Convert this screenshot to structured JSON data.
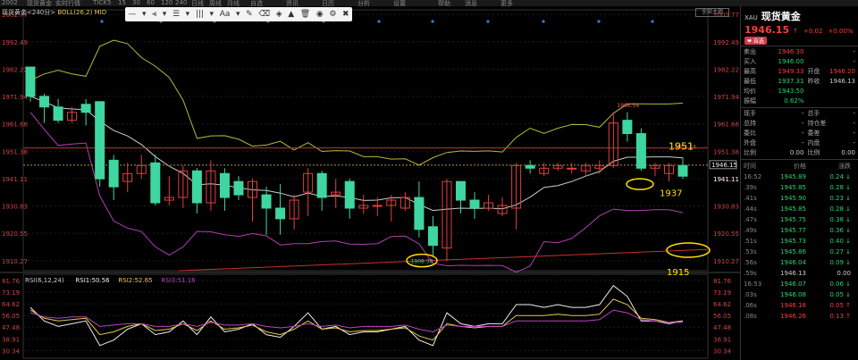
{
  "topbar": [
    "2002",
    "现货黄金",
    "实时行情",
    "TICK",
    "5",
    "15",
    "30",
    "60",
    "120",
    "240",
    "日线",
    "周线",
    "月线",
    "自选",
    "资讯",
    "日历",
    "分析",
    "设置",
    "帮助",
    "消息",
    "更多"
  ],
  "legend": {
    "symbol": "现货黄金<240分>",
    "boll": "BOLL(26,2) MID"
  },
  "toolbar": [
    "—",
    "▾",
    "⫷",
    "▾",
    "☰",
    "▾",
    "|||",
    "▾",
    "Aa",
    "▾",
    "✎",
    "⌫",
    "◈",
    "▲",
    "🗑",
    "◉",
    "⚙",
    "✖"
  ],
  "button_tr": "全部主题",
  "chart_data": {
    "type": "candlestick",
    "y_ticks": [
      2002.77,
      1992.49,
      1982.22,
      1971.94,
      1961.66,
      1951.38,
      1941.11,
      1930.83,
      1920.55,
      1910.27
    ],
    "y_tick_labels": [
      "2002.77",
      "1992.49",
      "1982.22",
      "1971.94",
      "1961.66",
      "1951.38",
      "1941.11",
      "1930.83",
      "1920.55",
      "1910.27"
    ],
    "ylim": [
      1906.5,
      2004.5
    ],
    "candles": [
      [
        1983,
        1972,
        1983,
        1970
      ],
      [
        1972,
        1968,
        1973,
        1962
      ],
      [
        1968,
        1963,
        1971,
        1962
      ],
      [
        1963,
        1966,
        1968,
        1962
      ],
      [
        1969,
        1966,
        1971,
        1961
      ],
      [
        1970,
        1941,
        1970,
        1938
      ],
      [
        1948,
        1938,
        1950,
        1933
      ],
      [
        1940,
        1943,
        1947,
        1936
      ],
      [
        1943,
        1946,
        1950,
        1941
      ],
      [
        1947,
        1932,
        1950,
        1931
      ],
      [
        1933,
        1934,
        1942,
        1931
      ],
      [
        1934,
        1944,
        1946,
        1930
      ],
      [
        1944,
        1932,
        1945,
        1928
      ],
      [
        1932,
        1944,
        1948,
        1929
      ],
      [
        1943,
        1934,
        1945,
        1929
      ],
      [
        1940,
        1935,
        1942,
        1933
      ],
      [
        1934,
        1940,
        1941,
        1925
      ],
      [
        1935,
        1930,
        1938,
        1920
      ],
      [
        1930,
        1926,
        1939,
        1920
      ],
      [
        1926,
        1933,
        1935,
        1922
      ],
      [
        1936,
        1943,
        1945,
        1927
      ],
      [
        1943,
        1934,
        1944,
        1929
      ],
      [
        1935,
        1936,
        1941,
        1930
      ],
      [
        1940,
        1930,
        1941,
        1926
      ],
      [
        1930,
        1931,
        1935,
        1928
      ],
      [
        1931,
        1931,
        1934,
        1927
      ],
      [
        1931,
        1933,
        1935,
        1925
      ],
      [
        1930,
        1934,
        1936,
        1929
      ],
      [
        1934,
        1922,
        1940,
        1919
      ],
      [
        1923,
        1916,
        1927,
        1912
      ],
      [
        1915,
        1940,
        1941,
        1910
      ],
      [
        1940,
        1933,
        1940,
        1928
      ],
      [
        1933,
        1930,
        1936,
        1926
      ],
      [
        1930,
        1932,
        1935,
        1929
      ],
      [
        1928,
        1931,
        1934,
        1927
      ],
      [
        1930,
        1946,
        1947,
        1922
      ],
      [
        1946,
        1945,
        1948,
        1943
      ],
      [
        1943,
        1945,
        1947,
        1942
      ],
      [
        1945,
        1946,
        1947,
        1944
      ],
      [
        1945,
        1945,
        1947,
        1943
      ],
      [
        1944,
        1946,
        1947,
        1942
      ],
      [
        1945,
        1946,
        1948,
        1943
      ],
      [
        1946,
        1962,
        1966,
        1945
      ],
      [
        1963,
        1958,
        1966,
        1955
      ],
      [
        1958,
        1945,
        1960,
        1944
      ],
      [
        1945,
        1946,
        1947,
        1942
      ],
      [
        1943,
        1946,
        1947,
        1940
      ],
      [
        1946,
        1942,
        1949,
        1941
      ]
    ],
    "annotations": {
      "top_label": "1966.54",
      "low_label": "1908.38",
      "line_label": "1951.24",
      "level_1951": "1951",
      "level_1937": "1937",
      "level_1915": "1915",
      "current_box": "1946.15",
      "current_sub": "1941.11"
    },
    "rsi": {
      "legend": [
        "RSI(6,12,24)",
        "RSI1:50.56",
        "RSI2:52.65",
        "RSI3:51.16"
      ],
      "y_labels": [
        "81.76",
        "73.19",
        "64.62",
        "56.05",
        "47.48",
        "38.91",
        "30.34"
      ],
      "ylim": [
        26,
        85
      ],
      "rsi1": [
        62,
        52,
        48,
        50,
        52,
        34,
        38,
        46,
        50,
        42,
        44,
        52,
        42,
        55,
        44,
        46,
        50,
        42,
        40,
        48,
        58,
        46,
        48,
        42,
        44,
        44,
        46,
        48,
        38,
        34,
        58,
        50,
        48,
        50,
        50,
        64,
        64,
        62,
        64,
        62,
        62,
        64,
        78,
        70,
        52,
        52,
        50,
        52
      ],
      "rsi2": [
        60,
        54,
        52,
        53,
        54,
        42,
        44,
        48,
        50,
        45,
        46,
        50,
        45,
        52,
        46,
        47,
        49,
        44,
        42,
        46,
        52,
        46,
        47,
        44,
        45,
        45,
        46,
        47,
        41,
        38,
        50,
        48,
        47,
        48,
        48,
        56,
        56,
        56,
        57,
        56,
        56,
        57,
        68,
        64,
        54,
        53,
        51,
        52
      ],
      "rsi3": [
        58,
        55,
        54,
        55,
        55,
        48,
        49,
        50,
        50,
        48,
        48,
        50,
        48,
        51,
        49,
        49,
        50,
        48,
        47,
        48,
        50,
        48,
        49,
        47,
        48,
        48,
        48,
        49,
        46,
        44,
        49,
        48,
        48,
        48,
        48,
        52,
        52,
        52,
        52,
        52,
        52,
        53,
        60,
        58,
        53,
        52,
        51,
        51
      ]
    }
  },
  "panel": {
    "code": "XAU",
    "name": "现货黄金",
    "price": "1946.15",
    "arrow": "↑",
    "change": "+0.02",
    "pct": "+0.00%",
    "badge": "❤ 自选",
    "rows": [
      {
        "c1": "卖出",
        "c2": "1946.30",
        "c3": "",
        "c4": "-",
        "k2": "red",
        "k4": ""
      },
      {
        "c1": "买入",
        "c2": "1946.00",
        "c3": "",
        "c4": "-",
        "k2": "green",
        "k4": ""
      },
      {
        "c1": "最高",
        "c2": "1949.33",
        "c3": "开盘",
        "c4": "1946.20",
        "k2": "red",
        "k4": "red"
      },
      {
        "c1": "最低",
        "c2": "1937.31",
        "c3": "昨收",
        "c4": "1946.13",
        "k2": "green",
        "k4": ""
      },
      {
        "c1": "均价",
        "c2": "1943.50",
        "c3": "",
        "c4": "",
        "k2": "green",
        "k4": ""
      },
      {
        "c1": "振幅",
        "c2": "0.62%",
        "c3": "",
        "c4": "",
        "k2": "green",
        "k4": ""
      }
    ],
    "rows2": [
      {
        "c1": "现手",
        "c2": "-",
        "c3": "总手",
        "c4": "-"
      },
      {
        "c1": "总持",
        "c2": "-",
        "c3": "持仓差",
        "c4": "-"
      },
      {
        "c1": "委比",
        "c2": "-",
        "c3": "委差",
        "c4": "-"
      },
      {
        "c1": "外盘",
        "c2": "-",
        "c3": "内盘",
        "c4": "-"
      },
      {
        "c1": "比例",
        "c2": "0.00",
        "c3": "比例",
        "c4": "0.00"
      }
    ],
    "tick_header": [
      "时间",
      "价格",
      "涨跌"
    ],
    "ticks": [
      {
        "t": "16:52",
        "p": "1945.89",
        "v": "0.24",
        "pc": "green",
        "vc": "green",
        "ar": "↓"
      },
      {
        "t": ".39s",
        "p": "1945.85",
        "v": "0.28",
        "pc": "green",
        "vc": "green",
        "ar": "↓"
      },
      {
        "t": ".41s",
        "p": "1945.90",
        "v": "0.23",
        "pc": "green",
        "vc": "green",
        "ar": "↓"
      },
      {
        "t": ".44s",
        "p": "1945.85",
        "v": "0.28",
        "pc": "green",
        "vc": "green",
        "ar": "↓"
      },
      {
        "t": ".47s",
        "p": "1945.75",
        "v": "0.38",
        "pc": "green",
        "vc": "green",
        "ar": "↓"
      },
      {
        "t": ".49s",
        "p": "1945.77",
        "v": "0.36",
        "pc": "green",
        "vc": "green",
        "ar": "↓"
      },
      {
        "t": ".51s",
        "p": "1945.73",
        "v": "0.40",
        "pc": "green",
        "vc": "green",
        "ar": "↓"
      },
      {
        "t": ".53s",
        "p": "1945.86",
        "v": "0.27",
        "pc": "green",
        "vc": "green",
        "ar": "↓"
      },
      {
        "t": ".56s",
        "p": "1946.04",
        "v": "0.09",
        "pc": "green",
        "vc": "green",
        "ar": "↓"
      },
      {
        "t": ".59s",
        "p": "1946.13",
        "v": "0.00",
        "pc": "",
        "vc": "",
        "ar": ""
      },
      {
        "t": "16:53",
        "p": "1946.07",
        "v": "0.06",
        "pc": "green",
        "vc": "green",
        "ar": "↓"
      },
      {
        "t": ".03s",
        "p": "1946.08",
        "v": "0.05",
        "pc": "green",
        "vc": "green",
        "ar": "↓"
      },
      {
        "t": ".06s",
        "p": "1946.18",
        "v": "0.05",
        "pc": "red",
        "vc": "red",
        "ar": "↑"
      },
      {
        "t": ".08s",
        "p": "1946.26",
        "v": "0.13",
        "pc": "red",
        "vc": "red",
        "ar": "↑"
      }
    ]
  }
}
